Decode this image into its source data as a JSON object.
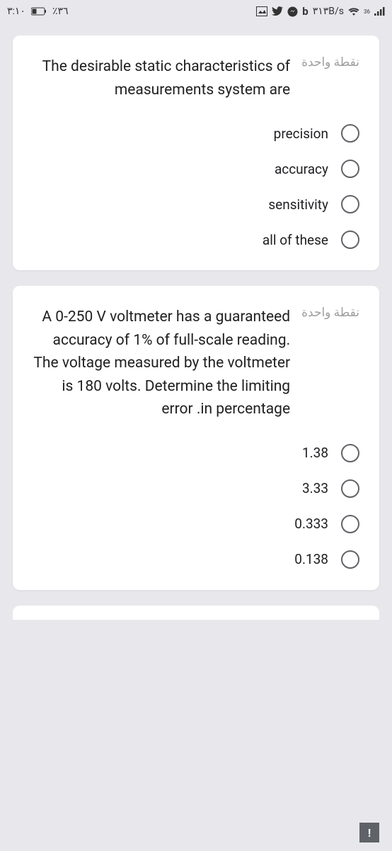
{
  "statusBar": {
    "time": "٣:١٠",
    "batteryPercent": "٪٣٦",
    "networkSpeed": "٣١٣B/s",
    "signalBadge": "36"
  },
  "questions": [
    {
      "points": "نقطة واحدة",
      "text": "The desirable static characteristics of measurements system are",
      "options": [
        "precision",
        "accuracy",
        "sensitivity",
        "all of these"
      ]
    },
    {
      "points": "نقطة واحدة",
      "text": "A 0-250 V voltmeter has a guaranteed accuracy of 1% of full-scale reading. The voltage measured by the voltmeter is 180 volts. Determine the limiting error .in percentage",
      "options": [
        "1.38",
        "3.33",
        "0.333",
        "0.138"
      ]
    }
  ],
  "fab": {
    "label": "!"
  }
}
